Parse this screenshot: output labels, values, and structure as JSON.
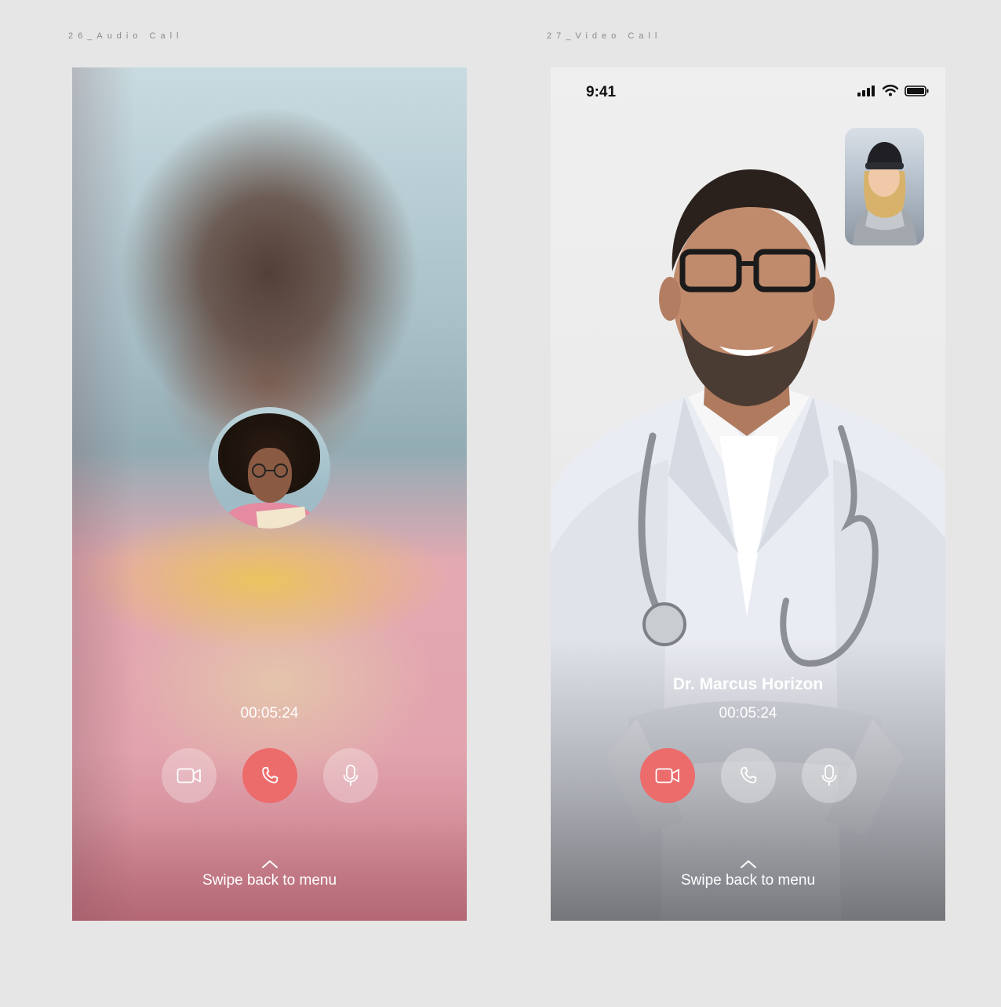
{
  "audio_call": {
    "frame_label": "26_Audio Call",
    "timer": "00:05:24",
    "swipe_label": "Swipe back to menu",
    "buttons": {
      "video": {
        "icon": "video-camera-icon",
        "state": "inactive"
      },
      "call": {
        "icon": "phone-icon",
        "state": "active"
      },
      "mic": {
        "icon": "microphone-icon",
        "state": "inactive"
      }
    }
  },
  "video_call": {
    "frame_label": "27_Video Call",
    "status_time": "9:41",
    "callee_name": "Dr. Marcus Horizon",
    "timer": "00:05:24",
    "swipe_label": "Swipe back to menu",
    "buttons": {
      "video": {
        "icon": "video-camera-icon",
        "state": "active"
      },
      "call": {
        "icon": "phone-icon",
        "state": "inactive"
      },
      "mic": {
        "icon": "microphone-icon",
        "state": "inactive"
      }
    }
  },
  "colors": {
    "background": "#e6e6e6",
    "accent_red": "#ec6b6b",
    "button_muted": "rgba(255,255,255,0.28)",
    "text_light": "#ffffff"
  }
}
